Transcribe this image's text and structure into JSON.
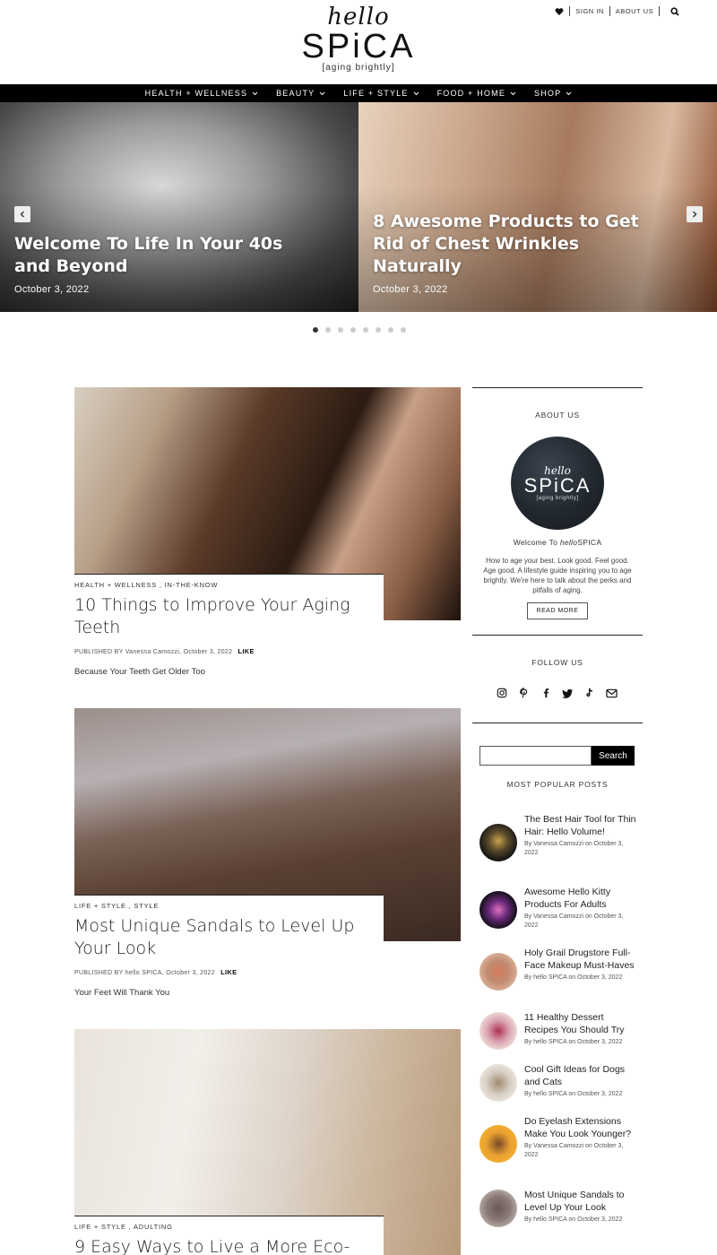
{
  "header": {
    "logo_hello": "hello",
    "logo_spica": "SPiCA",
    "logo_tag": "[aging brightly]",
    "sign_in": "SIGN IN",
    "about_us": "ABOUT US"
  },
  "nav": {
    "items": [
      {
        "label": "HEALTH + WELLNESS"
      },
      {
        "label": "BEAUTY"
      },
      {
        "label": "LIFE + STYLE"
      },
      {
        "label": "FOOD + HOME"
      },
      {
        "label": "SHOP"
      }
    ]
  },
  "slider": {
    "slides": [
      {
        "title": "Welcome To Life In Your 40s and Beyond",
        "date": "October 3, 2022"
      },
      {
        "title": "8 Awesome Products to Get Rid of Chest Wrinkles Naturally",
        "date": "October 3, 2022"
      }
    ],
    "dot_count": 8,
    "active_dot": 1
  },
  "posts": [
    {
      "categories": "HEALTH + WELLNESS , IN-THE-KNOW",
      "title": "10 Things to Improve Your Aging Teeth",
      "published_by": "PUBLISHED BY",
      "author_date": "Vanessa Camozzi, October 3, 2022",
      "like": "LIKE",
      "excerpt": "Because Your Teeth Get Older Too"
    },
    {
      "categories": "LIFE + STYLE , STYLE",
      "title": "Most Unique Sandals to Level Up Your Look",
      "published_by": "PUBLISHED BY",
      "author_date": "hello SPICA, October 3, 2022",
      "like": "LIKE",
      "excerpt": "Your Feet Will Thank You"
    },
    {
      "categories": "LIFE + STYLE , ADULTING",
      "title": "9 Easy Ways to Live a More Eco-"
    }
  ],
  "sidebar": {
    "about_heading": "ABOUT US",
    "circle_hello": "hello",
    "circle_spica": "SPiCA",
    "circle_tag": "[aging brightly]",
    "welcome_prefix": "Welcome To ",
    "welcome_hello": "hello",
    "welcome_spica": "SPICA",
    "about_text": "How to age your best. Look good. Feel good. Age good. A lifestyle guide inspiring you to age brightly. We're here to talk about the perks and pitfalls of aging.",
    "read_more": "READ MORE",
    "follow_heading": "FOLLOW US",
    "social_icons": [
      "instagram-icon",
      "pinterest-icon",
      "facebook-icon",
      "twitter-icon",
      "tiktok-icon",
      "email-icon"
    ],
    "search_placeholder": "",
    "search_button": "Search",
    "popular_heading": "MOST POPULAR POSTS",
    "popular": [
      {
        "title": "The Best Hair Tool for Thin Hair: Hello Volume!",
        "by": "By Vanessa Camozzi on October 3, 2022"
      },
      {
        "title": "Awesome Hello Kitty Products For Adults",
        "by": "By Vanessa Camozzi on October 3, 2022"
      },
      {
        "title": "Holy Grail Drugstore Full-Face Makeup Must-Haves",
        "by": "By hello SPICA on October 3, 2022"
      },
      {
        "title": "11 Healthy Dessert Recipes You Should Try",
        "by": "By hello SPICA on October 3, 2022"
      },
      {
        "title": "Cool Gift Ideas for Dogs and Cats",
        "by": "By hello SPICA on October 3, 2022"
      },
      {
        "title": "Do Eyelash Extensions Make You Look Younger?",
        "by": "By Vanessa Camozzi on October 3, 2022"
      },
      {
        "title": "Most Unique Sandals to Level Up Your Look",
        "by": "By hello SPICA on October 3, 2022"
      }
    ]
  },
  "colors": {
    "nav_bg": "#000000",
    "text": "#222222",
    "search_button_bg": "#000000"
  }
}
